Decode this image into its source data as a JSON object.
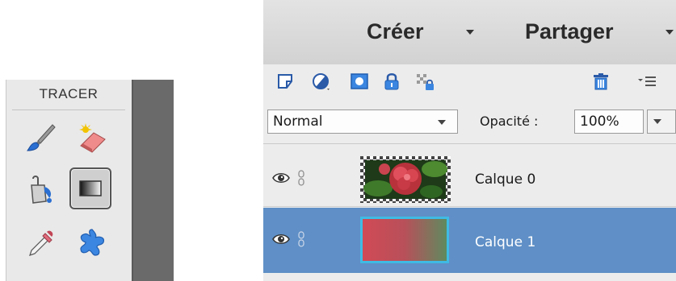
{
  "tools_panel": {
    "title": "TRACER",
    "tools": [
      {
        "name": "brush-tool-icon"
      },
      {
        "name": "smart-brush-eraser-tool-icon"
      },
      {
        "name": "paint-bucket-tool-icon"
      },
      {
        "name": "gradient-tool-icon",
        "selected": true
      },
      {
        "name": "eyedropper-tool-icon"
      },
      {
        "name": "custom-shape-tool-icon"
      }
    ]
  },
  "menu": {
    "create": "Créer",
    "share": "Partager"
  },
  "layers_toolbar": {
    "icons": [
      "new-layer-icon",
      "adjustment-layer-icon",
      "layer-mask-icon",
      "lock-icon",
      "lock-transparency-icon",
      "trash-icon",
      "panel-menu-icon"
    ]
  },
  "blend": {
    "mode": "Normal",
    "opacity_label": "Opacité :",
    "opacity_value": "100%"
  },
  "layers": [
    {
      "name": "Calque 0",
      "selected": false
    },
    {
      "name": "Calque 1",
      "selected": true
    }
  ],
  "colors": {
    "selection": "#5f8fc6",
    "selected_thumb_border": "#3fbbe4",
    "gradient_start": "#d04a55",
    "gradient_end": "#5f8a5e"
  }
}
